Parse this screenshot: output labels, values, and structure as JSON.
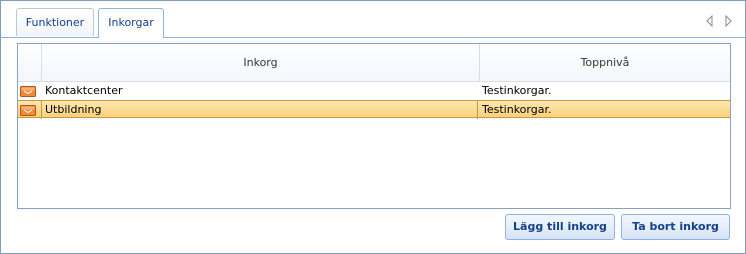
{
  "tabs": [
    {
      "label": "Funktioner",
      "active": false
    },
    {
      "label": "Inkorgar",
      "active": true
    }
  ],
  "tab_scroll": {
    "left_icon": "scroll-left-icon",
    "right_icon": "scroll-right-icon"
  },
  "grid": {
    "columns": [
      "Inkorg",
      "Toppnivå"
    ],
    "rows": [
      {
        "icon": "inbox-icon",
        "inkorg": "Kontaktcenter",
        "toppniva": "Testinkorgar.",
        "selected": false
      },
      {
        "icon": "inbox-icon",
        "inkorg": "Utbildning",
        "toppniva": "Testinkorgar.",
        "selected": true
      }
    ]
  },
  "buttons": {
    "add_label": "Lägg till inkorg",
    "remove_label": "Ta bort inkorg"
  },
  "colors": {
    "accent": "#15428b",
    "border": "#8db2e3",
    "selection": "#f9d17c",
    "inbox_icon": "#e8792a"
  }
}
